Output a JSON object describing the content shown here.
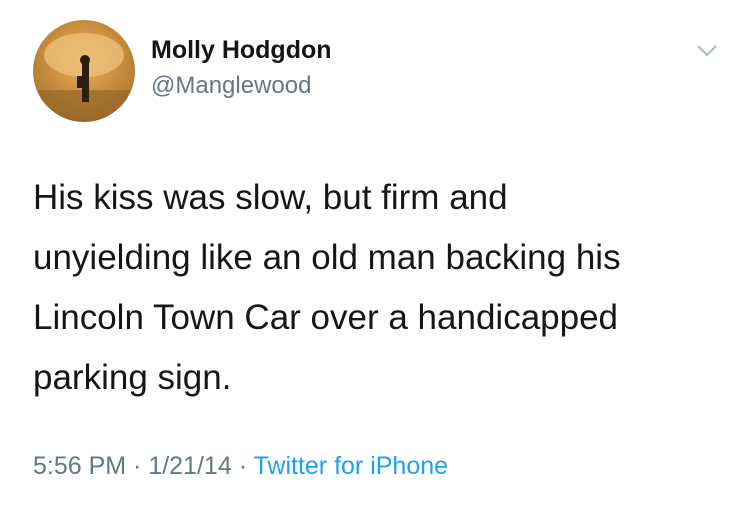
{
  "user": {
    "name": "Molly Hodgdon",
    "handle": "@Manglewood"
  },
  "tweet": {
    "lines": [
      "His kiss was slow, but firm and",
      "unyielding like an old man backing his",
      "Lincoln Town Car over a handicapped",
      "parking sign."
    ],
    "time": "5:56 PM",
    "separator_1": " · ",
    "date": "1/21/14",
    "separator_2": " · ",
    "source": "Twitter for iPhone"
  },
  "icons": {
    "menu": "chevron-down-icon",
    "avatar": "profile-photo"
  },
  "colors": {
    "text": "#14171a",
    "secondary": "#657786",
    "link": "#1da1f2",
    "background": "#ffffff"
  }
}
